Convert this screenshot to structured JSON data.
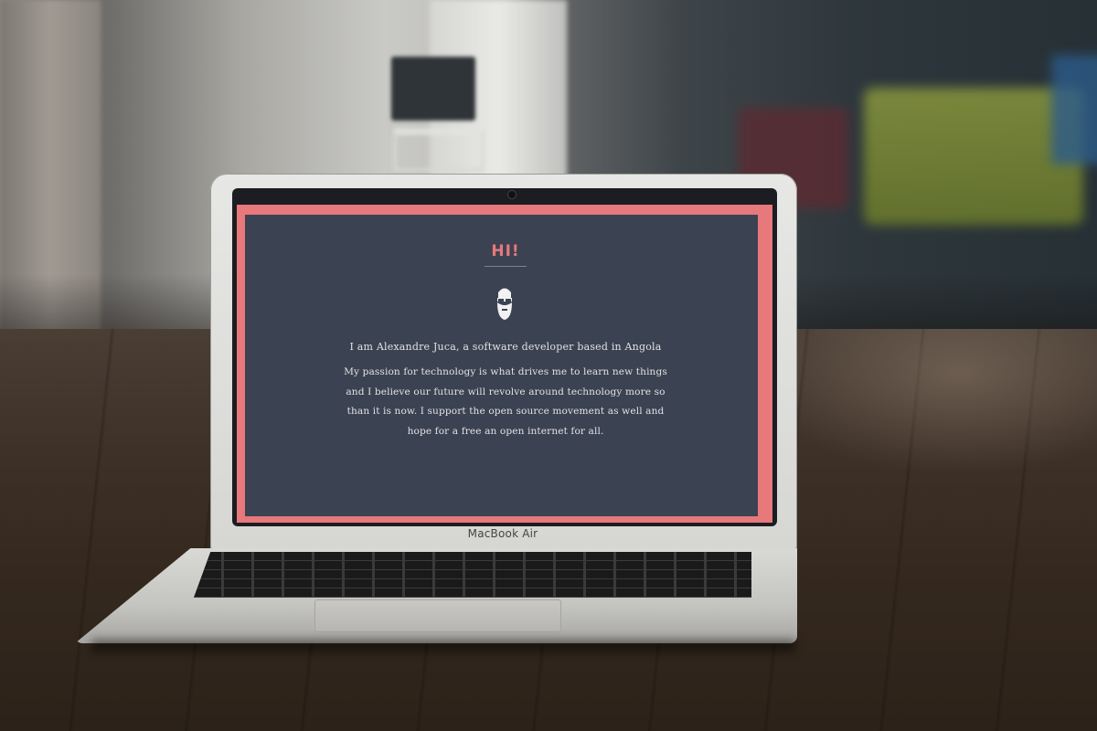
{
  "screen": {
    "greeting": "HI!",
    "intro": "I am Alexandre Juca, a software developer based in Angola",
    "bio": "My passion for technology is what drives me to learn new things and I believe our future will revolve around technology more so than it is now. I support the open source movement as well and hope for a free an open internet for all.",
    "avatar_icon": "bearded-man-glasses-icon"
  },
  "laptop": {
    "brand_label": "MacBook Air"
  },
  "colors": {
    "accent": "#e7787b",
    "screen_bg": "#3b4252",
    "text": "#e2e2e2"
  }
}
